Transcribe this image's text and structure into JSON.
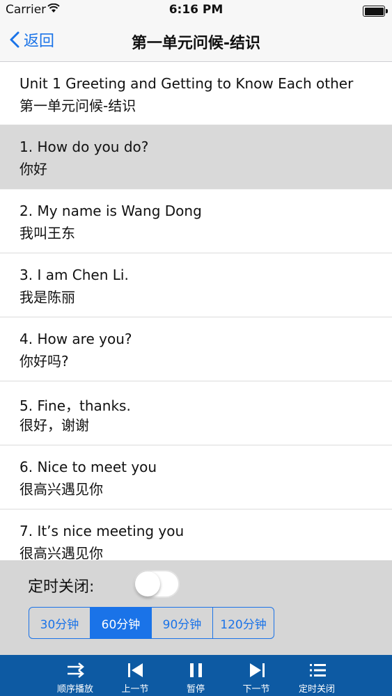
{
  "status": {
    "carrier": "Carrier",
    "time": "6:16 PM"
  },
  "nav": {
    "back_label": "返回",
    "title": "第一单元问候-结识"
  },
  "header_row": {
    "en": "Unit 1  Greeting and Getting to Know Each other",
    "zh": "第一单元问候-结识"
  },
  "items": [
    {
      "en": "1.  How do you do?",
      "zh": "你好"
    },
    {
      "en": "2.  My name is Wang Dong",
      "zh": "我叫王东"
    },
    {
      "en": "3.  I am Chen Li.",
      "zh": "我是陈丽"
    },
    {
      "en": "4.  How are you?",
      "zh": "你好吗?"
    },
    {
      "en": "5.  Fine，thanks.",
      "zh": "很好，谢谢"
    },
    {
      "en": "6.  Nice to meet you",
      "zh": "很高兴遇见你"
    },
    {
      "en": "7.  It’s nice meeting you",
      "zh": "很高兴遇见你"
    }
  ],
  "timer": {
    "label": "定时关闭:",
    "switch_on": false,
    "options": [
      "30分钟",
      "60分钟",
      "90分钟",
      "120分钟"
    ],
    "selected": "60分钟"
  },
  "toolbar": {
    "order": "顺序播放",
    "prev": "上一节",
    "pause": "暂停",
    "next": "下一节",
    "timer_close": "定时关闭"
  },
  "colors": {
    "accent": "#1a73e8",
    "toolbar_bg": "#0d5aa3",
    "selected_row": "#d9d9d9"
  }
}
